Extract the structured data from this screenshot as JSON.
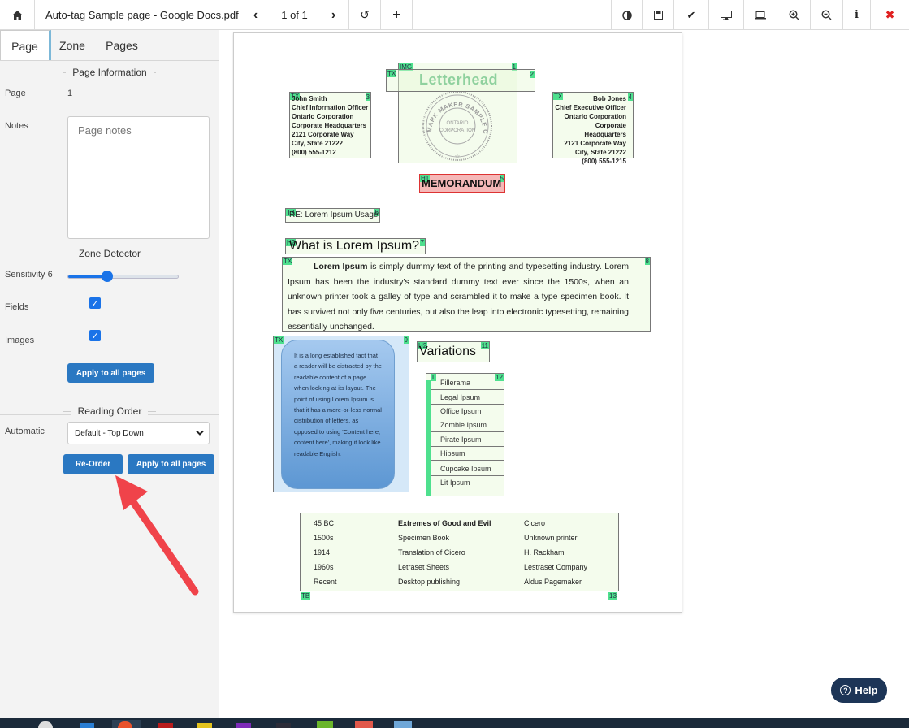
{
  "toolbar": {
    "title": "Auto-tag Sample page - Google Docs.pdf",
    "page_indicator": "1 of 1"
  },
  "sidebar": {
    "tabs": [
      "Page",
      "Zone",
      "Pages"
    ],
    "page_info": {
      "title": "Page Information",
      "page_label": "Page",
      "page_value": "1",
      "notes_label": "Notes",
      "notes_placeholder": "Page notes"
    },
    "zone_detector": {
      "title": "Zone Detector",
      "sensitivity_label": "Sensitivity 6",
      "sensitivity_value": 6,
      "fields_label": "Fields",
      "fields_checked": true,
      "images_label": "Images",
      "images_checked": true,
      "apply_label": "Apply to all pages"
    },
    "reading_order": {
      "title": "Reading Order",
      "automatic_label": "Automatic",
      "select_value": "Default - Top Down",
      "reorder_label": "Re-Order",
      "apply_label": "Apply to all pages"
    }
  },
  "document": {
    "letterhead": "Letterhead",
    "seal_text": {
      "ring": "MARK MAKER SAMPLE COMPANY",
      "center1": "ONTARIO",
      "center2": "CORPORATION"
    },
    "left_address": [
      "John Smith",
      "Chief Information Officer",
      "Ontario Corporation",
      "Corporate Headquarters",
      "2121 Corporate Way",
      "City, State 21222",
      "(800) 555-1212"
    ],
    "right_address": [
      "Bob Jones",
      "Chief Executive Officer",
      "Ontario Corporation",
      "Corporate Headquarters",
      "2121 Corporate Way",
      "City, State 21222",
      "(800) 555-1215"
    ],
    "memo": "MEMORANDUM",
    "subject": "RE: Lorem Ipsum Usage",
    "heading": "What is Lorem Ipsum?",
    "para_bold": "Lorem Ipsum",
    "para_rest": " is simply dummy text of the printing and typesetting industry. Lorem Ipsum has been the industry's standard dummy text ever since the 1500s, when an unknown printer took a galley of type and scrambled it to make a type specimen book. It has survived not only five centuries, but also the leap into electronic typesetting, remaining essentially unchanged.",
    "callout": "It is a long established fact that a reader will be distracted by the readable content of a page when looking at its layout. The point of using Lorem Ipsum is that it has a more-or-less normal distribution of letters, as opposed to using 'Content here, content here', making it look like readable English.",
    "variations_heading": "Variations",
    "list": [
      "Fillerama",
      "Legal Ipsum",
      "Office Ipsum",
      "Zombie Ipsum",
      "Pirate Ipsum",
      "Hipsum",
      "Cupcake Ipsum",
      "Lit Ipsum"
    ],
    "table": [
      [
        "45 BC",
        "Extremes of Good and Evil",
        "Cicero"
      ],
      [
        "1500s",
        "Specimen Book",
        "Unknown printer"
      ],
      [
        "1914",
        "Translation of Cicero",
        "H. Rackham"
      ],
      [
        "1960s",
        "Letraset Sheets",
        "Lestraset Company"
      ],
      [
        "Recent",
        "Desktop publishing",
        "Aldus Pagemaker"
      ]
    ]
  },
  "zones": {
    "img": {
      "tag": "IMG",
      "num": "1"
    },
    "letterhead": {
      "tag": "TX",
      "num": "2"
    },
    "left_addr": {
      "tag": "TX",
      "num": "3"
    },
    "right_addr": {
      "tag": "TX",
      "num": "4"
    },
    "memo": {
      "tag": "H1",
      "num": "5"
    },
    "subject": {
      "tag": "TX",
      "num": "6"
    },
    "heading": {
      "tag": "H2",
      "num": "7"
    },
    "para": {
      "tag": "TX",
      "num": "8"
    },
    "callout": {
      "tag": "TX",
      "num": "9"
    },
    "variations": {
      "tag": "H2",
      "num": "11"
    },
    "list": {
      "tag": "L",
      "num": "12"
    },
    "table": {
      "tag": "TB",
      "num": "13"
    }
  },
  "help_label": "Help",
  "colors": {
    "accent": "#2a78c2",
    "zone_tag": "#4ee08e",
    "zone_fill": "#eaf8dc",
    "memo_fill": "#f5b8b8",
    "callout": "#7fb2e5",
    "help": "#1d3557",
    "arrow": "#f0434a"
  }
}
